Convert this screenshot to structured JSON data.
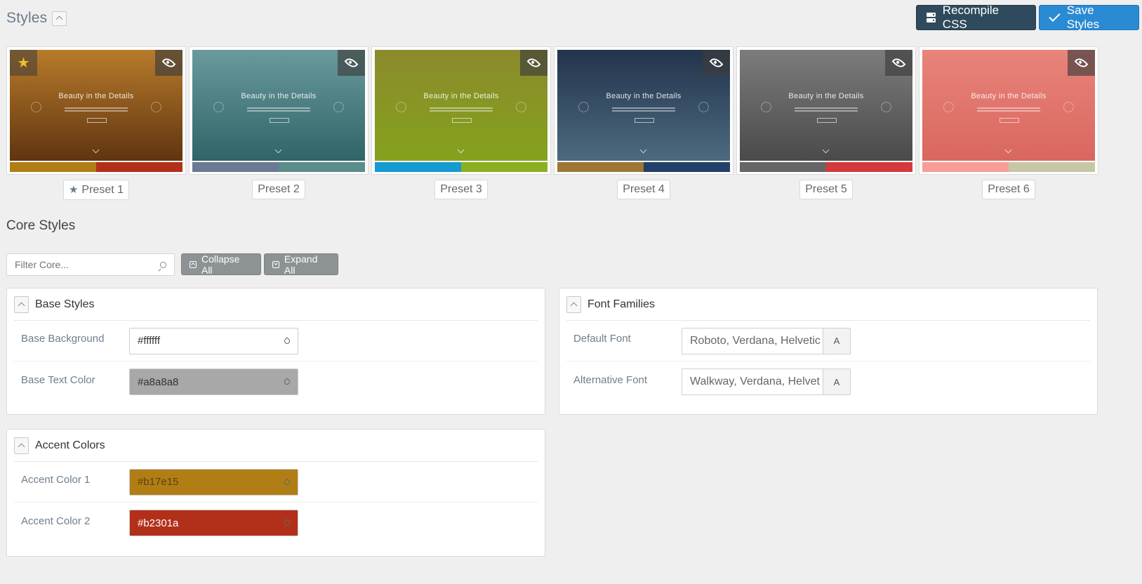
{
  "header": {
    "title": "Styles",
    "recompile_label": "Recompile CSS",
    "save_label": "Save Styles"
  },
  "presets": [
    {
      "label": "Preset 1",
      "active": true,
      "bg": "#b87b2a",
      "bg2": "#5f3410",
      "swatch1": "#b17e15",
      "swatch2": "#b2301a"
    },
    {
      "label": "Preset 2",
      "active": false,
      "bg": "#6a9a9c",
      "bg2": "#2f6468",
      "swatch1": "#6c7993",
      "swatch2": "#5a8c8a"
    },
    {
      "label": "Preset 3",
      "active": false,
      "bg": "#8c8a2c",
      "bg2": "#84a21c",
      "swatch1": "#159ad1",
      "swatch2": "#8ab022"
    },
    {
      "label": "Preset 4",
      "active": false,
      "bg": "#23344d",
      "bg2": "#4c6a7e",
      "swatch1": "#9c7834",
      "swatch2": "#22406a"
    },
    {
      "label": "Preset 5",
      "active": false,
      "bg": "#7c7c7c",
      "bg2": "#4a4a4a",
      "swatch1": "#666666",
      "swatch2": "#d4393b"
    },
    {
      "label": "Preset 6",
      "active": false,
      "bg": "#e8847b",
      "bg2": "#d9675f",
      "swatch1": "#f79d97",
      "swatch2": "#c7c7a7"
    }
  ],
  "thumb_text": "Beauty in the Details",
  "core": {
    "title": "Core Styles",
    "filter_placeholder": "Filter Core...",
    "collapse_all": "Collapse All",
    "expand_all": "Expand All"
  },
  "base_styles": {
    "title": "Base Styles",
    "rows": [
      {
        "label": "Base Background",
        "value": "#ffffff",
        "bg": "#ffffff",
        "fg": "#333333"
      },
      {
        "label": "Base Text Color",
        "value": "#a8a8a8",
        "bg": "#a8a8a8",
        "fg": "#333333"
      }
    ]
  },
  "font_families": {
    "title": "Font Families",
    "rows": [
      {
        "label": "Default Font",
        "value": "Roboto, Verdana, Helvetic",
        "button": "A"
      },
      {
        "label": "Alternative Font",
        "value": "Walkway, Verdana, Helvet",
        "button": "A"
      }
    ]
  },
  "accent_colors": {
    "title": "Accent Colors",
    "rows": [
      {
        "label": "Accent Color 1",
        "value": "#b17e15",
        "bg": "#b17e15",
        "fg": "#5c4208"
      },
      {
        "label": "Accent Color 2",
        "value": "#b2301a",
        "bg": "#b2301a",
        "fg": "#ffffff"
      }
    ]
  }
}
